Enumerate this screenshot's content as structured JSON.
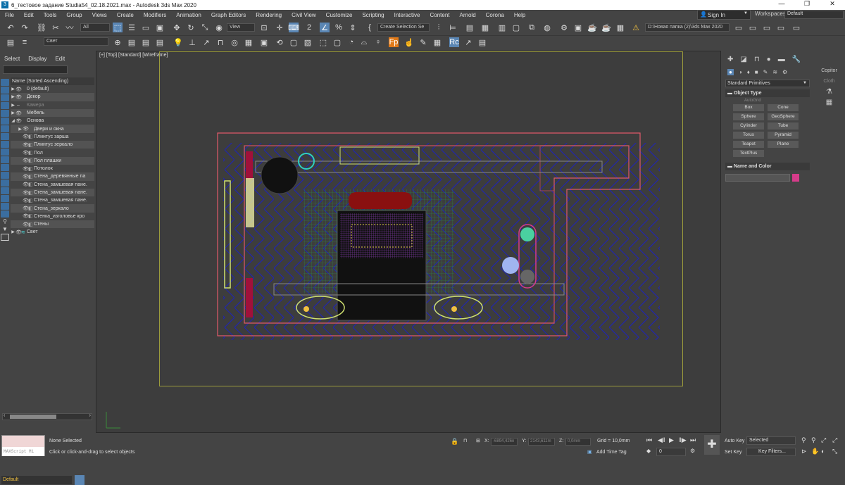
{
  "title": "6_тестовое задание Studia54_02.18.2021.max - Autodesk 3ds Max 2020",
  "menu": [
    "File",
    "Edit",
    "Tools",
    "Group",
    "Views",
    "Create",
    "Modifiers",
    "Animation",
    "Graph Editors",
    "Rendering",
    "Civil View",
    "Customize",
    "Scripting",
    "Interactive",
    "Content",
    "Arnold",
    "Corona",
    "Help"
  ],
  "signin": "Sign In",
  "workspaces_label": "Workspaces:",
  "workspaces_value": "Default",
  "toolbar": {
    "filter": "All",
    "view": "View",
    "selection_set": "Create Selection Se",
    "project_path": "D:\\Новая папка (2)\\3ds Max 2020",
    "layer": "Свет",
    "max_logo": "Fp",
    "rc_logo": "Rc"
  },
  "left_panel": {
    "tabs": [
      "Select",
      "Display",
      "Edit"
    ],
    "header": "Name (Sorted Ascending)",
    "rows": [
      {
        "name": "0 (default)",
        "level": 0,
        "arrow": "▶"
      },
      {
        "name": "Декор",
        "level": 0,
        "arrow": "▶"
      },
      {
        "name": "Камера",
        "level": 0,
        "arrow": "▶"
      },
      {
        "name": "Мебель",
        "level": 0,
        "arrow": "▶"
      },
      {
        "name": "Основа",
        "level": 0,
        "arrow": "◢"
      },
      {
        "name": "Двери и окна",
        "level": 1,
        "arrow": "▶"
      },
      {
        "name": "Плинтус зарша",
        "level": 1,
        "arrow": ""
      },
      {
        "name": "Плинтус зеркало",
        "level": 1,
        "arrow": ""
      },
      {
        "name": "Пол",
        "level": 1,
        "arrow": ""
      },
      {
        "name": "Пол плашки",
        "level": 1,
        "arrow": ""
      },
      {
        "name": "Потолок",
        "level": 1,
        "arrow": ""
      },
      {
        "name": "Стена_деревянные па",
        "level": 1,
        "arrow": ""
      },
      {
        "name": "Стена_замшевая пане.",
        "level": 1,
        "arrow": ""
      },
      {
        "name": "Стена_замшевая пане.",
        "level": 1,
        "arrow": ""
      },
      {
        "name": "Стена_замшевая пане.",
        "level": 1,
        "arrow": ""
      },
      {
        "name": "Стена_зеркало",
        "level": 1,
        "arrow": ""
      },
      {
        "name": "Стенка_изголовье кро",
        "level": 1,
        "arrow": ""
      },
      {
        "name": "Стены",
        "level": 1,
        "arrow": ""
      },
      {
        "name": "Свет",
        "level": 0,
        "arrow": "▶"
      }
    ],
    "layer_default": "Default"
  },
  "viewport": {
    "label": "[+] [Top] [Standard] [Wireframe]"
  },
  "command_panel": {
    "dropdown": "Standard Primitives",
    "section_object_type": "Object Type",
    "autogrid": "AutoGrid",
    "buttons": [
      "Box",
      "Cone",
      "Sphere",
      "GeoSphere",
      "Cylinder",
      "Tube",
      "Torus",
      "Pyramid",
      "Teapot",
      "Plane",
      "TextPlus"
    ],
    "section_name_color": "Name and Color",
    "swatch_color": "#d63c8a"
  },
  "right_strip": {
    "copitor": "Copitor",
    "cloth": "Cloth"
  },
  "status": {
    "maxscript": "MAXScript Mi",
    "none_selected": "None Selected",
    "hint": "Click or click-and-drag to select objects",
    "x_label": "X:",
    "x_value": "-6894,426n",
    "y_label": "Y:",
    "y_value": "2143,611m",
    "z_label": "Z:",
    "z_value": "0,0mm",
    "grid": "Grid = 10,0mm",
    "add_time_tag": "Add Time Tag",
    "auto_key": "Auto Key",
    "selected": "Selected",
    "set_key": "Set Key",
    "key_filters": "Key Filters...",
    "frame": "0"
  }
}
